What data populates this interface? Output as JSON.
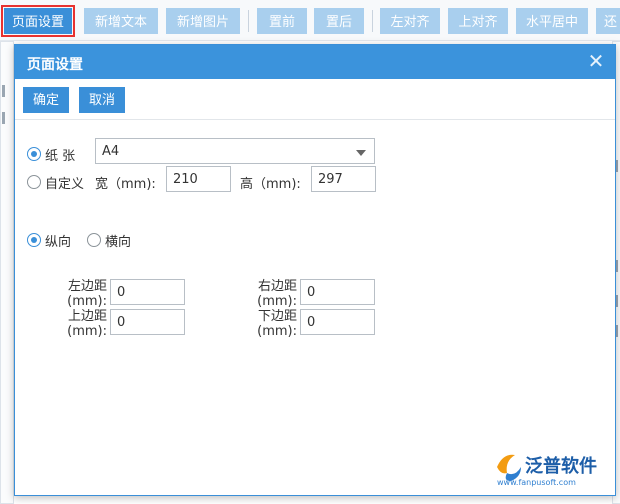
{
  "toolbar": {
    "buttons": [
      "页面设置",
      "新增文本",
      "新增图片",
      "置前",
      "置后",
      "左对齐",
      "上对齐",
      "水平居中",
      "还"
    ]
  },
  "dialog": {
    "title": "页面设置",
    "confirm": "确定",
    "cancel": "取消",
    "paper": {
      "radio_label": "纸 张",
      "selected_size": "A4",
      "custom_label": "自定义",
      "width_label": "宽（mm):",
      "width_value": "210",
      "height_label": "高（mm):",
      "height_value": "297"
    },
    "orientation": {
      "portrait": "纵向",
      "landscape": "横向"
    },
    "margins": {
      "left_label": "左边距",
      "right_label": "右边距",
      "top_label": "上边距",
      "bottom_label": "下边距",
      "unit_label": "(mm):",
      "left": "0",
      "right": "0",
      "top": "0",
      "bottom": "0"
    }
  },
  "watermark": {
    "brand": "泛普软件",
    "url": "www.fanpusoft.com"
  },
  "colors": {
    "primary": "#3a8fd8",
    "toolbar_button": "#a9cfee",
    "highlight": "#e8322f",
    "brand_orange": "#f39c12"
  }
}
